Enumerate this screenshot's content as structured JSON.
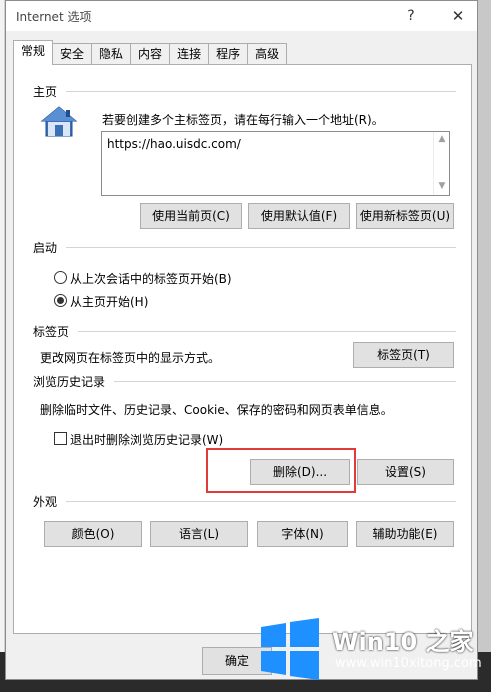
{
  "window": {
    "title": "Internet 选项",
    "help_label": "?",
    "close_label": "✕"
  },
  "tabs": [
    {
      "label": "常规",
      "active": true
    },
    {
      "label": "安全"
    },
    {
      "label": "隐私"
    },
    {
      "label": "内容"
    },
    {
      "label": "连接"
    },
    {
      "label": "程序"
    },
    {
      "label": "高级"
    }
  ],
  "homepage": {
    "group_title": "主页",
    "instruction": "若要创建多个主标签页，请在每行输入一个地址(R)。",
    "url": "https://hao.uisdc.com/",
    "btn_current": "使用当前页(C)",
    "btn_default": "使用默认值(F)",
    "btn_newtab": "使用新标签页(U)"
  },
  "startup": {
    "group_title": "启动",
    "option_last_session": "从上次会话中的标签页开始(B)",
    "option_home": "从主页开始(H)",
    "selected": "option_home"
  },
  "tabs_section": {
    "group_title": "标签页",
    "description": "更改网页在标签页中的显示方式。",
    "btn_tabs": "标签页(T)"
  },
  "history": {
    "group_title": "浏览历史记录",
    "description": "删除临时文件、历史记录、Cookie、保存的密码和网页表单信息。",
    "checkbox_label": "退出时删除浏览历史记录(W)",
    "checkbox_checked": false,
    "btn_delete": "删除(D)...",
    "btn_settings": "设置(S)"
  },
  "appearance": {
    "group_title": "外观",
    "btn_colors": "颜色(O)",
    "btn_languages": "语言(L)",
    "btn_fonts": "字体(N)",
    "btn_accessibility": "辅助功能(E)"
  },
  "footer": {
    "ok_label": "确定"
  },
  "watermark": {
    "title": "Win10 之家",
    "url": "www.win10xitong.com"
  },
  "colors": {
    "highlight": "#e03a3a",
    "home_icon_blue": "#3b6fb6"
  }
}
